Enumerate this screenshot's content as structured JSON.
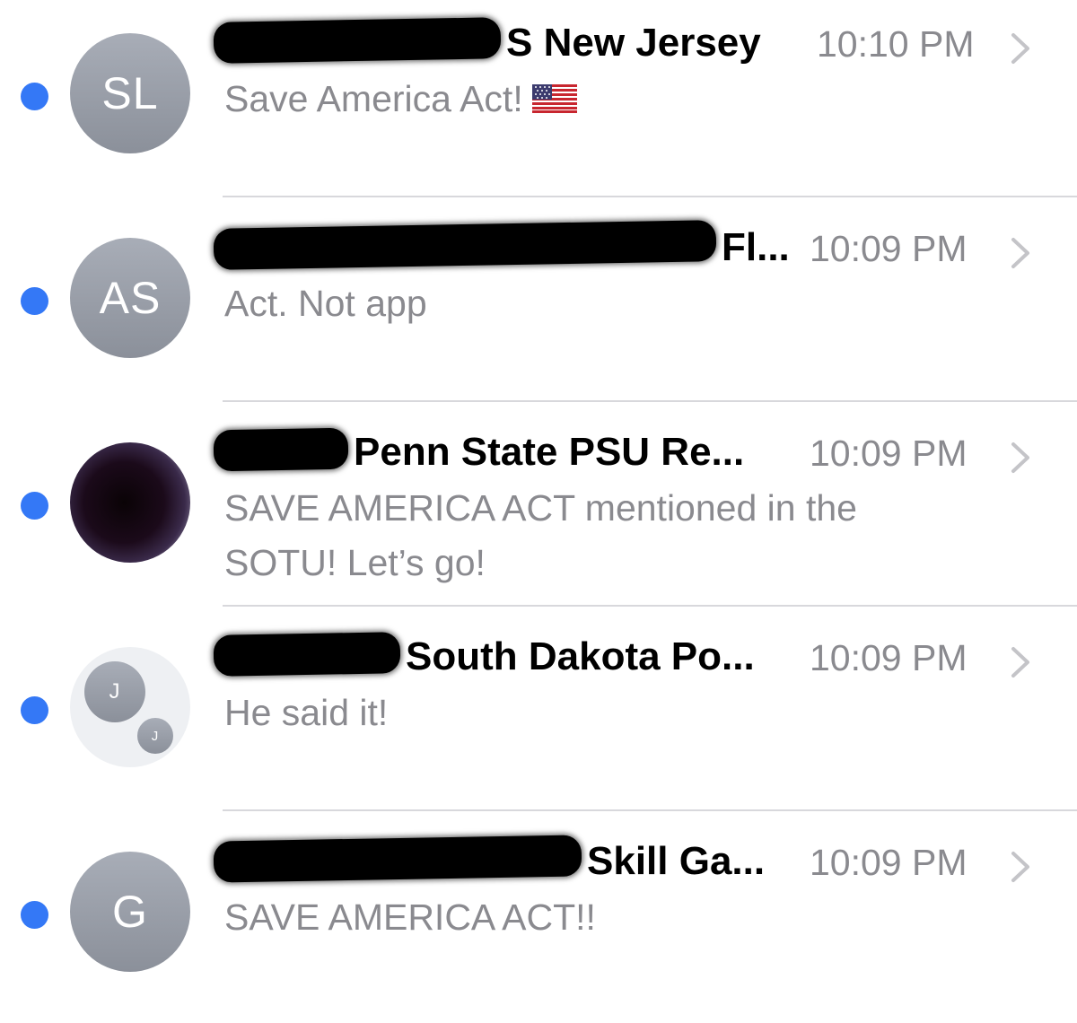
{
  "conversations": [
    {
      "initials": "SL",
      "name_visible": "S New Jersey",
      "time": "10:10 PM",
      "preview": "Save America Act!",
      "preview_emoji": "us-flag-icon",
      "unread": true
    },
    {
      "initials": "AS",
      "name_visible": "Fl...",
      "time": "10:09 PM",
      "preview": "Act.  Not app",
      "unread": true
    },
    {
      "initials": "",
      "name_visible": "Penn State PSU Re...",
      "time": "10:09 PM",
      "preview": "SAVE AMERICA ACT mentioned in the SOTU! Let’s go!",
      "unread": true
    },
    {
      "initials_primary": "J",
      "initials_secondary": "J",
      "name_visible": "South Dakota Po...",
      "time": "10:09 PM",
      "preview": "He said it!",
      "unread": true
    },
    {
      "initials": "G",
      "name_visible": "Skill Ga...",
      "time": "10:09 PM",
      "preview": "SAVE AMERICA ACT!!",
      "unread": true
    }
  ],
  "colors": {
    "unread_dot": "#3478f6",
    "avatar": "#9ca1ab",
    "secondary_text": "#8a8a8f",
    "separator": "#d8d8dc"
  }
}
